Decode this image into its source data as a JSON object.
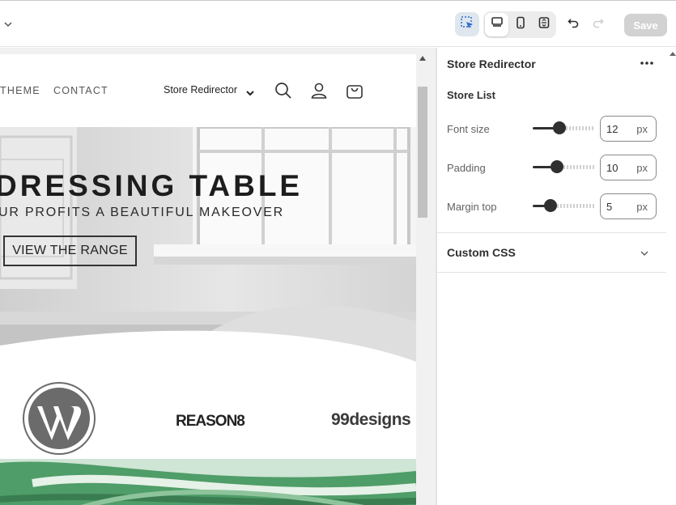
{
  "toolbar": {
    "save_label": "Save",
    "accent_color": "#2c6ecb"
  },
  "preview": {
    "nav": {
      "theme_label": "THEME",
      "contact_label": "CONTACT",
      "store_redirector_value": "Store Redirector"
    },
    "hero": {
      "title": "DRESSING TABLE",
      "subtitle": "UR PROFITS A BEAUTIFUL MAKEOVER",
      "button_label": "VIEW THE RANGE"
    },
    "logos": {
      "reason_text": "REASON8",
      "designs_text": "99designs"
    }
  },
  "panel": {
    "title": "Store Redirector",
    "section_title": "Store List",
    "settings": [
      {
        "label": "Font size",
        "value": "12",
        "unit": "px",
        "level": 0.42
      },
      {
        "label": "Padding",
        "value": "10",
        "unit": "px",
        "level": 0.36
      },
      {
        "label": "Margin top",
        "value": "5",
        "unit": "px",
        "level": 0.24
      }
    ],
    "custom_css_label": "Custom CSS"
  }
}
